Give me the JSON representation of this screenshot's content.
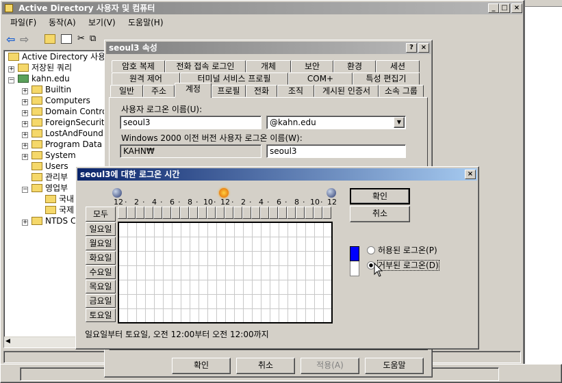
{
  "main_window": {
    "title": "Active Directory 사용자 및 컴퓨터",
    "menu": [
      "파일(F)",
      "동작(A)",
      "보기(V)",
      "도움말(H)"
    ],
    "tree": {
      "root": "Active Directory 사용자",
      "saved_queries": "저장된 쿼리",
      "domain": "kahn.edu",
      "items": [
        "Builtin",
        "Computers",
        "Domain Contro",
        "ForeignSecurit",
        "LostAndFound",
        "Program Data",
        "System",
        "Users",
        "관리부",
        "영업부",
        "국내",
        "국제",
        "NTDS C"
      ]
    }
  },
  "properties_dialog": {
    "title": "seoul3 속성",
    "tabs_row1": [
      "암호 복제",
      "전화 접속 로그인",
      "개체",
      "보안",
      "환경",
      "세션"
    ],
    "tabs_row2": [
      "원격 제어",
      "터미널 서비스 프로필",
      "COM+",
      "특성 편집기"
    ],
    "tabs_row3": [
      "일반",
      "주소",
      "계정",
      "프로필",
      "전화",
      "조직",
      "게시된 인증서",
      "소속 그룹"
    ],
    "logon_name_label": "사용자 로그온 이름(U):",
    "logon_name_value": "seoul3",
    "domain_suffix": "@kahn.edu",
    "pre2000_label": "Windows 2000 이전 버전 사용자 로그온 이름(W):",
    "pre2000_domain": "KAHN₩",
    "pre2000_name": "seoul3",
    "buttons": {
      "ok": "확인",
      "cancel": "취소",
      "apply": "적용(A)",
      "help": "도움말"
    }
  },
  "logon_hours_dialog": {
    "title": "seoul3에 대한 로그온 시간",
    "hour_labels": [
      "12",
      "2",
      "4",
      "6",
      "8",
      "10",
      "12",
      "2",
      "4",
      "6",
      "8",
      "10",
      "12"
    ],
    "all_label": "모두",
    "days": [
      "일요일",
      "월요일",
      "화요일",
      "수요일",
      "목요일",
      "금요일",
      "토요일"
    ],
    "ok": "확인",
    "cancel": "취소",
    "radio_permitted": "허용된 로그온(P)",
    "radio_denied": "거부된 로그온(D)",
    "selected_option": "denied",
    "status_text": "일요일부터 토요일, 오전 12:00부터 오전 12:00까지",
    "colors": {
      "permitted": "#0000ff",
      "denied": "#ffffff"
    }
  }
}
